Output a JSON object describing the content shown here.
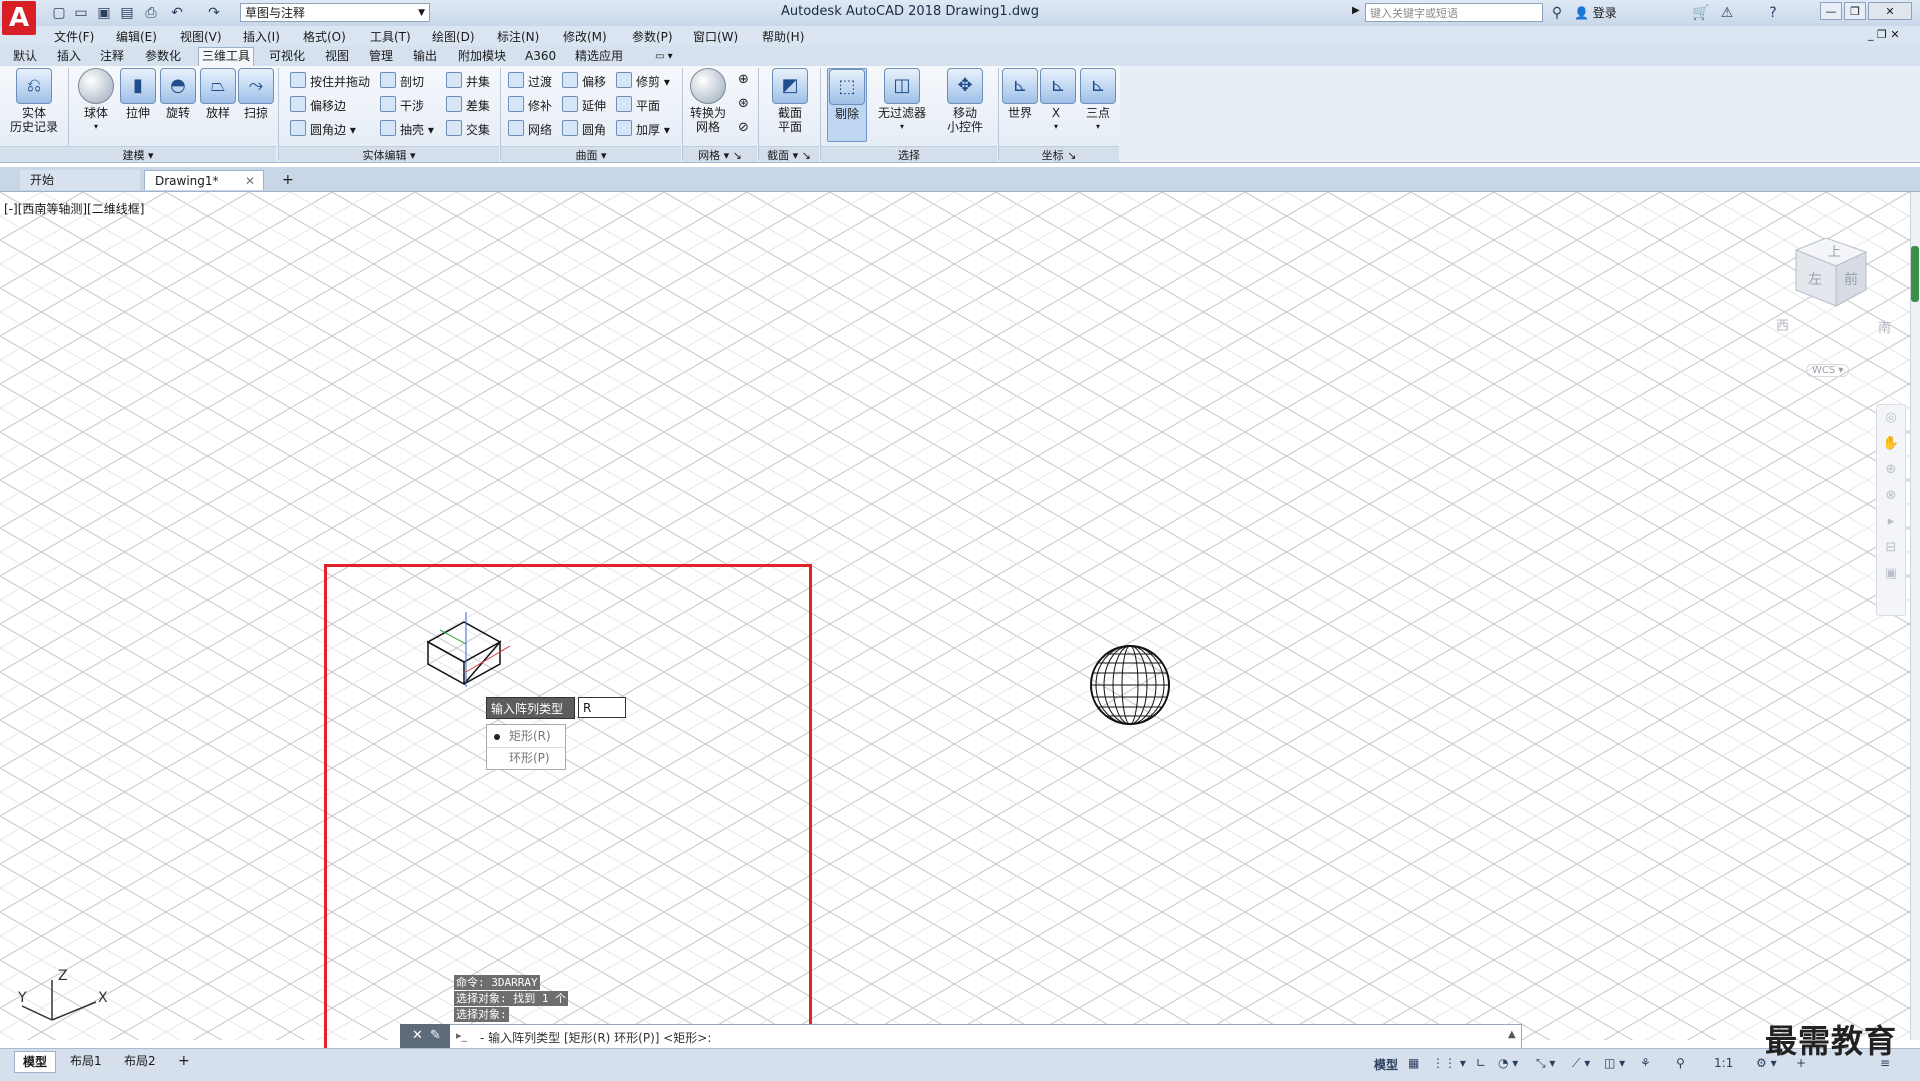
{
  "titlebar": {
    "app_logo": "A",
    "workspace": "草图与注释",
    "window_title": "Autodesk AutoCAD 2018    Drawing1.dwg",
    "search_placeholder": "键入关键字或短语",
    "login": "登录"
  },
  "menubar": {
    "items": [
      "文件(F)",
      "编辑(E)",
      "视图(V)",
      "插入(I)",
      "格式(O)",
      "工具(T)",
      "绘图(D)",
      "标注(N)",
      "修改(M)",
      "参数(P)",
      "窗口(W)",
      "帮助(H)"
    ]
  },
  "ribbon_tabs": {
    "items": [
      "默认",
      "插入",
      "注释",
      "参数化",
      "三维工具",
      "可视化",
      "视图",
      "管理",
      "输出",
      "附加模块",
      "A360",
      "精选应用"
    ],
    "active": "三维工具"
  },
  "ribbon": {
    "history_label": "实体\n历史记录",
    "modeling": {
      "title": "建模",
      "sphere": "球体",
      "extrude": "拉伸",
      "revolve": "旋转",
      "loft": "放样",
      "sweep": "扫掠"
    },
    "solid_edit": {
      "title": "实体编辑",
      "presspull": "按住并拖动",
      "offset_edge": "偏移边",
      "fillet_edge": "圆角边",
      "slice": "剖切",
      "interfere": "干涉",
      "shell": "抽壳",
      "union": "并集",
      "subtract": "差集",
      "intersect": "交集"
    },
    "surface": {
      "title": "曲面",
      "blend": "过渡",
      "patch": "修补",
      "network": "网络",
      "offset": "偏移",
      "extend": "延伸",
      "fillet": "圆角",
      "trim": "修剪",
      "plane": "平面",
      "thicken": "加厚"
    },
    "mesh": {
      "title": "网格",
      "convert": "转换为\n网格"
    },
    "section": {
      "title": "截面",
      "plane": "截面\n平面"
    },
    "selection": {
      "title": "选择",
      "culling": "剔除",
      "no_filter": "无过滤器",
      "gizmo": "移动\n小控件"
    },
    "coords": {
      "title": "坐标",
      "world": "世界",
      "x": "X",
      "three_point": "三点"
    }
  },
  "file_tabs": {
    "start": "开始",
    "drawing": "Drawing1*"
  },
  "viewport": {
    "label": "[-][西南等轴测][二维线框]",
    "viewcube_top": "上",
    "viewcube_left": "左",
    "viewcube_front": "前",
    "compass_w": "西",
    "compass_s": "南",
    "wcs": "WCS",
    "ucs_x": "X",
    "ucs_y": "Y",
    "ucs_z": "Z"
  },
  "dynamic_input": {
    "prompt": "输入阵列类型",
    "value": "R",
    "options": [
      "矩形(R)",
      "环形(P)"
    ]
  },
  "command": {
    "history": [
      "命令: 3DARRAY",
      "选择对象: 找到 1 个",
      "选择对象:"
    ],
    "prompt": "- 输入阵列类型 [矩形(R) 环形(P)] <矩形>:"
  },
  "layout_tabs": [
    "模型",
    "布局1",
    "布局2"
  ],
  "status": {
    "model": "模型",
    "scale": "1:1"
  },
  "watermark": "最需教育",
  "colors": {
    "accent": "#d81f26",
    "frame": "#e2212a",
    "ribbon": "#e3ebf5"
  }
}
